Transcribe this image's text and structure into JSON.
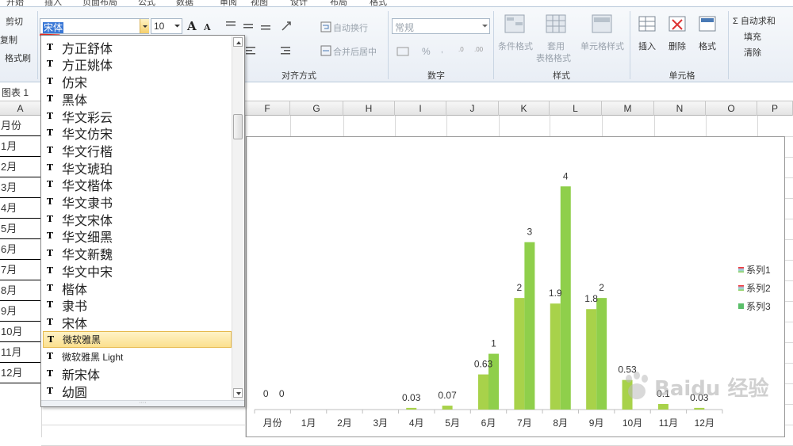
{
  "ribbon": {
    "tabs": [
      "开始",
      "插入",
      "页面布局",
      "公式",
      "数据",
      "审阅",
      "视图",
      "设计",
      "布局",
      "格式"
    ],
    "clipboard": {
      "cut": "剪切",
      "copy": "复制",
      "format_painter": "格式刷"
    },
    "font": {
      "name": "宋体",
      "size": "10",
      "grow": "A",
      "shrink": "A"
    },
    "alignment": {
      "wrap_text": "自动换行",
      "merge_center": "合并后居中",
      "group_label": "对齐方式"
    },
    "number": {
      "format": "常规",
      "percent": "%",
      "group_label": "数字"
    },
    "styles": {
      "conditional": "条件格式",
      "table_format_1": "套用",
      "table_format_2": "表格格式",
      "cell_styles": "单元格样式",
      "group_label": "样式"
    },
    "cells": {
      "insert": "插入",
      "delete": "删除",
      "format": "格式",
      "group_label": "单元格"
    },
    "editing": {
      "autosum": "Σ 自动求和",
      "fill": "填充",
      "clear": "清除"
    }
  },
  "sheet": {
    "name_box": "图表 1",
    "columns": [
      "A",
      "F",
      "G",
      "H",
      "I",
      "J",
      "K",
      "L",
      "M",
      "N",
      "O",
      "P"
    ],
    "col_a_cells": [
      "月份",
      "1月",
      "2月",
      "3月",
      "4月",
      "5月",
      "6月",
      "7月",
      "8月",
      "9月",
      "10月",
      "11月",
      "12月"
    ]
  },
  "font_dropdown": {
    "items": [
      "方正舒体",
      "方正姚体",
      "仿宋",
      "黑体",
      "华文彩云",
      "华文仿宋",
      "华文行楷",
      "华文琥珀",
      "华文楷体",
      "华文隶书",
      "华文宋体",
      "华文细黑",
      "华文新魏",
      "华文中宋",
      "楷体",
      "隶书",
      "宋体",
      "微软雅黑",
      "微软雅黑 Light",
      "新宋体",
      "幼圆"
    ],
    "selected": "微软雅黑"
  },
  "chart_data": {
    "type": "bar",
    "categories": [
      "月份",
      "1月",
      "2月",
      "3月",
      "4月",
      "5月",
      "6月",
      "7月",
      "8月",
      "9月",
      "10月",
      "11月",
      "12月"
    ],
    "series": [
      {
        "name": "系列1",
        "values": [
          0,
          0,
          0,
          0,
          0.03,
          0.07,
          0.63,
          2,
          1.9,
          1.8,
          0.53,
          0.1,
          0.03
        ]
      },
      {
        "name": "系列2",
        "values": [
          0,
          0,
          0,
          0,
          0,
          0,
          1,
          3,
          4,
          2,
          0,
          0,
          0
        ]
      },
      {
        "name": "系列3",
        "values": []
      }
    ],
    "data_labels": [
      "0",
      "0",
      "0.03",
      "0.07",
      "0.63",
      "1",
      "2",
      "3",
      "1.9",
      "4",
      "1.8",
      "2",
      "0.53",
      "0.1",
      "0.03"
    ],
    "legend_position": "right",
    "colors": {
      "top": "#ff1f1f",
      "middle": "#9fd8f4",
      "bottom": "#8fcf4b",
      "s3": "#5bbf6a"
    },
    "ylim": [
      0,
      4.6
    ]
  },
  "watermark": "Baidu 经验"
}
